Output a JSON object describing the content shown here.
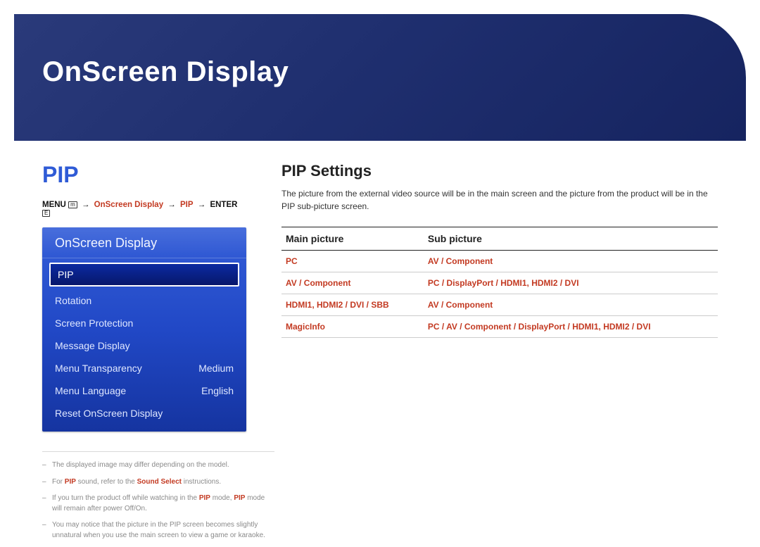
{
  "hero": {
    "title": "OnScreen Display"
  },
  "left": {
    "pip_title": "PIP",
    "breadcrumb": {
      "menu": "MENU",
      "menu_icon": "m",
      "seg1": "OnScreen Display",
      "seg2": "PIP",
      "enter": "ENTER",
      "enter_icon": "E",
      "arrow": "→"
    },
    "osd": {
      "header": "OnScreen Display",
      "items": [
        {
          "label": "PIP",
          "value": "",
          "selected": true
        },
        {
          "label": "Rotation",
          "value": ""
        },
        {
          "label": "Screen Protection",
          "value": ""
        },
        {
          "label": "Message Display",
          "value": ""
        },
        {
          "label": "Menu Transparency",
          "value": "Medium"
        },
        {
          "label": "Menu Language",
          "value": "English"
        },
        {
          "label": "Reset OnScreen Display",
          "value": ""
        }
      ]
    },
    "footnotes": {
      "n0": "The displayed image may differ depending on the model.",
      "n1_a": "For ",
      "n1_kw1": "PIP",
      "n1_b": " sound, refer to the ",
      "n1_kw2": "Sound Select",
      "n1_c": " instructions.",
      "n2_a": "If you turn the product off while watching in the ",
      "n2_kw1": "PIP",
      "n2_b": " mode, ",
      "n2_kw2": "PIP",
      "n2_c": " mode will remain after power Off/On.",
      "n3": "You may notice that the picture in the PIP screen becomes slightly unnatural when you use the main screen to view a game or karaoke."
    }
  },
  "right": {
    "title": "PIP Settings",
    "desc": "The picture from the external video source will be in the main screen and the picture from the product will be in the PIP sub-picture screen.",
    "table": {
      "head": {
        "main": "Main picture",
        "sub": "Sub picture"
      },
      "rows": [
        {
          "main": "PC",
          "sub": "AV / Component"
        },
        {
          "main": "AV / Component",
          "sub": "PC / DisplayPort / HDMI1, HDMI2 / DVI"
        },
        {
          "main": "HDMI1, HDMI2 / DVI / SBB",
          "sub": "AV / Component"
        },
        {
          "main": "MagicInfo",
          "sub": "PC / AV / Component / DisplayPort / HDMI1, HDMI2 / DVI"
        }
      ]
    }
  }
}
